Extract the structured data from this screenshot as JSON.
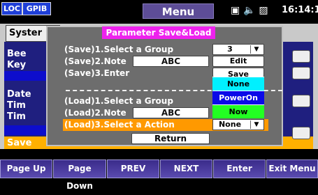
{
  "status_bar": {
    "loc": "LOC",
    "gpib": "GPIB",
    "title": "Menu",
    "icons": [
      "card-icon",
      "speaker-icon",
      "network-icon"
    ],
    "time": "16:14:1"
  },
  "background": {
    "tab": "Syster",
    "labels": [
      "Bee",
      "Key",
      "Date",
      "Tim",
      "Tim"
    ],
    "bottom_label": "Save"
  },
  "dialog": {
    "title": "Parameter Save&Load",
    "save_group_label": "(Save)1.Select a Group",
    "save_group_value": "3",
    "save_note_label": "(Save)2.Note",
    "save_note_value": "ABC",
    "edit_button": "Edit",
    "save_enter_label": "(Save)3.Enter",
    "save_button": "Save",
    "load_group_label": "(Load)1.Select a Group",
    "load_note_label": "(Load)2.Note",
    "load_note_value": "ABC",
    "load_action_label": "(Load)3.Select a Action",
    "load_action_value": "None",
    "action_options": [
      "None",
      "PowerOn",
      "Now"
    ],
    "return_button": "Return"
  },
  "softkeys": [
    "Page Up",
    "Page Down",
    "PREV",
    "NEXT",
    "Enter",
    "Exit Menu"
  ],
  "colors": {
    "title_bar": "#ee22ee",
    "highlight_row": "#ff9900",
    "softkey": "#4a3a9e"
  }
}
